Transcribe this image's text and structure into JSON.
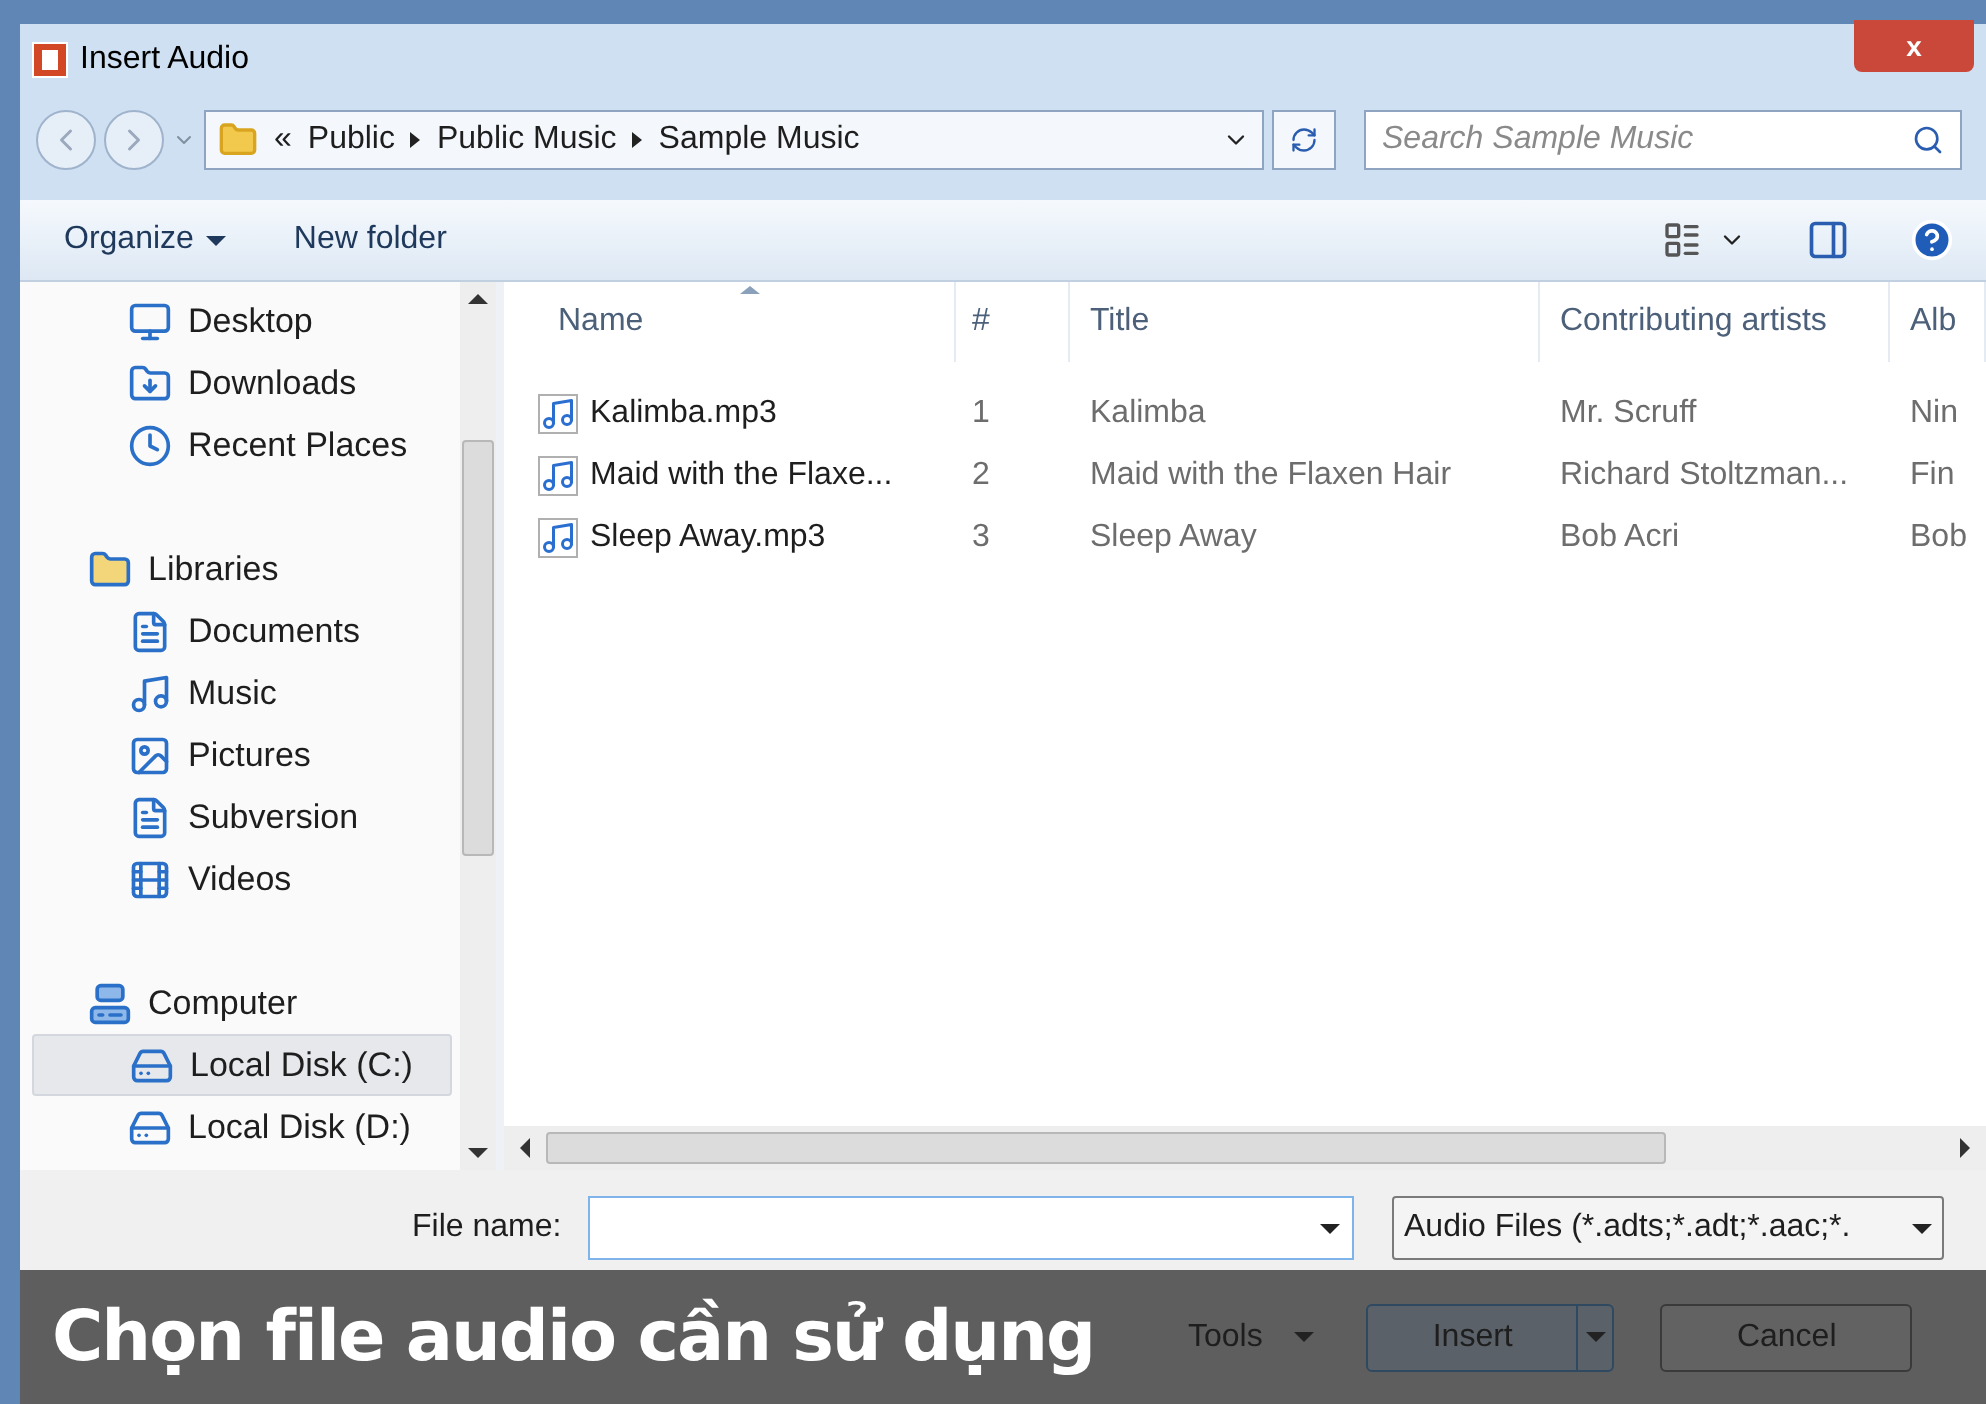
{
  "window": {
    "title": "Insert Audio",
    "close": "x"
  },
  "address": {
    "crumbs": [
      "«",
      "Public",
      "Public Music",
      "Sample Music"
    ],
    "search_placeholder": "Search Sample Music"
  },
  "toolbar": {
    "organize": "Organize",
    "new_folder": "New folder"
  },
  "sidebar": {
    "sections": [
      {
        "children": [
          {
            "label": "Desktop",
            "selected": false
          },
          {
            "label": "Downloads",
            "selected": false
          },
          {
            "label": "Recent Places",
            "selected": false
          }
        ]
      },
      {
        "label": "Libraries",
        "children": [
          {
            "label": "Documents",
            "selected": false
          },
          {
            "label": "Music",
            "selected": false
          },
          {
            "label": "Pictures",
            "selected": false
          },
          {
            "label": "Subversion",
            "selected": false
          },
          {
            "label": "Videos",
            "selected": false
          }
        ]
      },
      {
        "label": "Computer",
        "children": [
          {
            "label": "Local Disk (C:)",
            "selected": true
          },
          {
            "label": "Local Disk (D:)",
            "selected": false
          }
        ]
      }
    ]
  },
  "table": {
    "columns": [
      "Name",
      "#",
      "Title",
      "Contributing artists",
      "Alb"
    ],
    "rows": [
      [
        "Kalimba.mp3",
        "1",
        "Kalimba",
        "Mr. Scruff",
        "Nin"
      ],
      [
        "Maid with the Flaxe...",
        "2",
        "Maid with the Flaxen Hair",
        "Richard Stoltzman...",
        "Fin"
      ],
      [
        "Sleep Away.mp3",
        "3",
        "Sleep Away",
        "Bob Acri",
        "Bob"
      ]
    ]
  },
  "bottom": {
    "file_name_label": "File name:",
    "file_type": "Audio Files (*.adts;*.adt;*.aac;*.",
    "tools": "Tools",
    "insert": "Insert",
    "cancel": "Cancel"
  },
  "caption": "Chọn file audio cần sử dụng"
}
